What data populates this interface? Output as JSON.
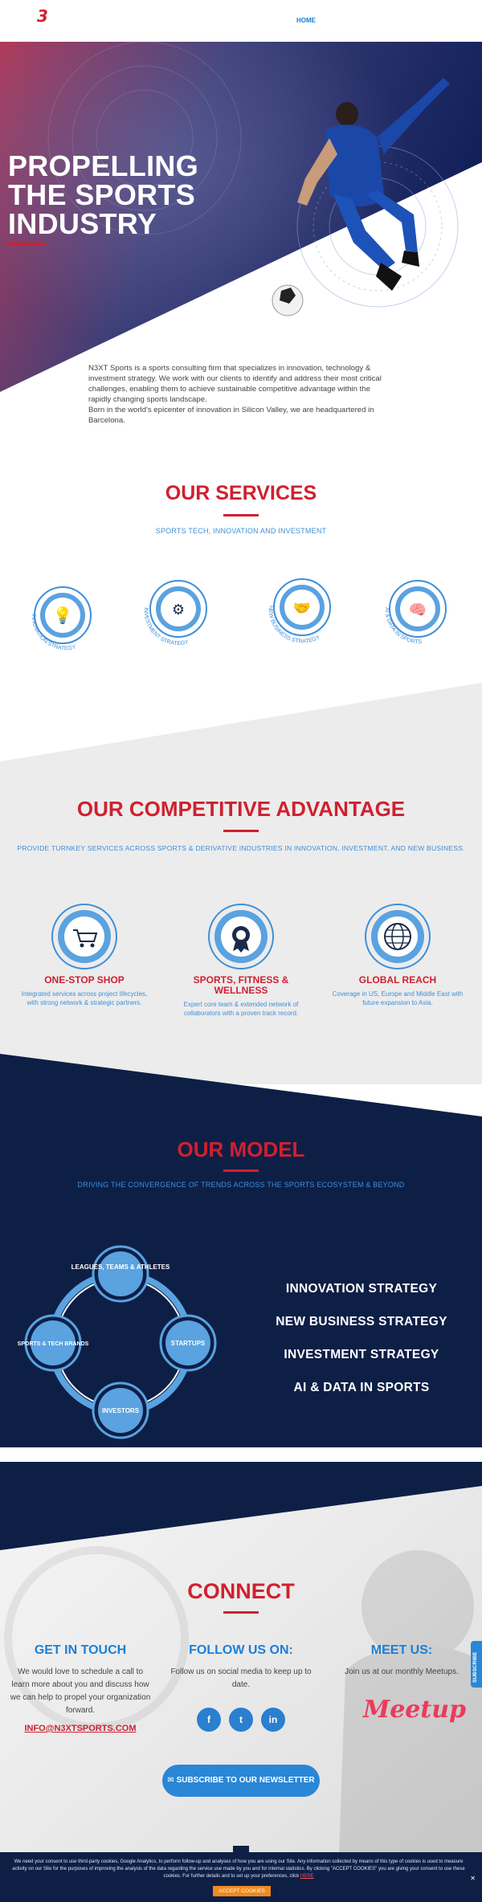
{
  "header": {
    "logo": "3",
    "nav_home": "HOME"
  },
  "hero": {
    "title": "PROPELLING THE SPORTS INDUSTRY",
    "intro": [
      "N3XT Sports is a sports consulting firm that specializes in innovation, technology & investment strategy. We work with our clients to identify and address their most critical challenges, enabling them to achieve sustainable competitive advantage within the rapidly changing sports landscape.",
      "Born in the world's epicenter of innovation in Silicon Valley, we are headquartered in Barcelona."
    ]
  },
  "services": {
    "title": "OUR SERVICES",
    "subtitle": "SPORTS TECH, INNOVATION AND INVESTMENT",
    "items": [
      {
        "label": "INNOVATION STRATEGY",
        "icon": "lightbulb-icon"
      },
      {
        "label": "INVESTMENT STRATEGY",
        "icon": "investment-icon"
      },
      {
        "label": "NEW BUSINESS STRATEGY",
        "icon": "handshake-icon"
      },
      {
        "label": "AI & DATA IN SPORTS",
        "icon": "brain-icon"
      }
    ]
  },
  "advantage": {
    "title": "OUR COMPETITIVE ADVANTAGE",
    "subtitle": "PROVIDE TURNKEY SERVICES ACROSS SPORTS & DERIVATIVE INDUSTRIES IN INNOVATION, INVESTMENT, AND NEW BUSINESS.",
    "items": [
      {
        "name": "ONE-STOP SHOP",
        "desc": "Integrated services across project lifecycles, with strong network & strategic partners.",
        "icon": "cart-icon"
      },
      {
        "name": "SPORTS, FITNESS & WELLNESS",
        "desc": "Expert core team & extended network of collaborators with a proven track record.",
        "icon": "medal-icon"
      },
      {
        "name": "GLOBAL REACH",
        "desc": "Coverage in US, Europe and Middle East with future expansion to Asia.",
        "icon": "globe-icon"
      }
    ]
  },
  "model": {
    "title": "OUR MODEL",
    "subtitle": "DRIVING THE CONVERGENCE OF TRENDS ACROSS THE SPORTS ECOSYSTEM & BEYOND",
    "nodes": [
      "LEAGUES, TEAMS & ATHLETES",
      "STARTUPS",
      "INVESTORS",
      "SPORTS & TECH BRANDS"
    ],
    "list": [
      "INNOVATION STRATEGY",
      "NEW BUSINESS STRATEGY",
      "INVESTMENT STRATEGY",
      "AI & DATA IN SPORTS"
    ]
  },
  "connect": {
    "title": "CONNECT",
    "get_in_touch": {
      "heading": "GET IN TOUCH",
      "text": "We would love to schedule a call to learn more about you and discuss how we can help to propel your organization forward.",
      "email": "INFO@N3XTSPORTS.COM"
    },
    "follow": {
      "heading": "FOLLOW US ON:",
      "text": "Follow us on social media to keep up to date.",
      "social": [
        "f",
        "t",
        "in"
      ]
    },
    "meet": {
      "heading": "MEET US:",
      "text": "Join us at our monthly Meetups.",
      "logo": "Meetup"
    },
    "newsletter": "SUBSCRIBE TO OUR NEWSLETTER",
    "subscribe_tab": "SUBSCRIBE"
  },
  "cookie": {
    "text": "We need your consent to use third-party cookies, Google Analytics, to perform follow-up and analyses of how you are using our Site. Any information collected by means of this type of cookies is used to measure activity on our Site for the purposes of improving the analysis of the data regarding the service use made by you and for internal statistics. By clicking \"ACCEPT COOKIES\" you are giving your consent to use these cookies. For further details and to set up your preferences, click",
    "link": "HERE",
    "accept": "ACCEPT COOKIES",
    "close": "✕"
  },
  "colors": {
    "red": "#d0202f",
    "blue": "#1b7fd6",
    "navy": "#0e1f46"
  }
}
